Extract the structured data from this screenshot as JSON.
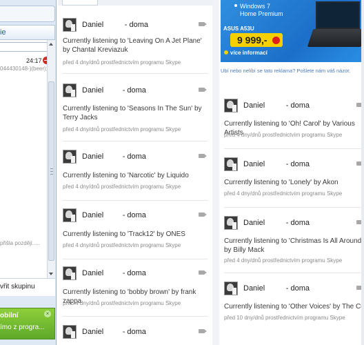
{
  "sidebar": {
    "section_label": "ie",
    "chat_time": "24:17",
    "chat_preview": "044430148-)(beer);",
    "late_text": "přišla později.....",
    "group_label": "vřit skupinu",
    "promo_title": "obilní",
    "promo_text": "ímo z progra..."
  },
  "feed_left": [
    {
      "name": "Daniel          - doma",
      "text": "Currently listening to 'Leaving On A Jet Plane' by Chantal Kreviazuk",
      "meta": "před 4 dny/dnů prostřednictvím programu Skype"
    },
    {
      "name": "Daniel         - doma",
      "text": "Currently listening to 'Seasons In The Sun' by Terry Jacks",
      "meta": "před 4 dny/dnů prostřednictvím programu Skype"
    },
    {
      "name": "Daniel         - doma",
      "text": "Currently listening to 'Narcotic' by Liquido",
      "meta": "před 4 dny/dnů prostřednictvím programu Skype"
    },
    {
      "name": "Daniel         - doma",
      "text": "Currently listening to 'Track12' by ONES",
      "meta": "před 4 dny/dnů prostřednictvím programu Skype"
    },
    {
      "name": "Daniel         - doma",
      "text": "Currently listening to 'bobby brown' by frank zappa",
      "meta": "před 4 dny/dnů prostřednictvím programu Skype"
    },
    {
      "name": "Daniel         - doma"
    }
  ],
  "ad": {
    "os_line1": "Windows 7",
    "os_line2": "Home Premium",
    "model": "ASUS A53U",
    "price": "9 999,-",
    "more": "více informací",
    "note": "Ubí nebo nelíbí se tato reklama? Pošlete nám váš názor."
  },
  "feed_right": [
    {
      "name": "Daniel          - doma",
      "text": "Currently listening to 'Oh! Carol' by Various Artists",
      "meta": "před 4 dny/dnů prostřednictvím programu Skype"
    },
    {
      "name": "Daniel          - doma",
      "text": "Currently listening to 'Lonely' by Akon",
      "meta": "před 4 dny/dnů prostřednictvím programu Skype"
    },
    {
      "name": "Daniel          - doma",
      "text": "Currently listening to 'Christmas Is All Around' by Billy Mack",
      "meta": "před 4 dny/dnů prostřednictvím programu Skype"
    },
    {
      "name": "Daniel          - doma",
      "text": "Currently listening to 'Other Voices' by The Cure",
      "meta": "před 10 dny/dnů prostřednictvím programu Skype"
    }
  ],
  "icons": {
    "avatar": "profile-photo-icon",
    "video": "video-camera-icon",
    "status": "red-status-icon"
  }
}
